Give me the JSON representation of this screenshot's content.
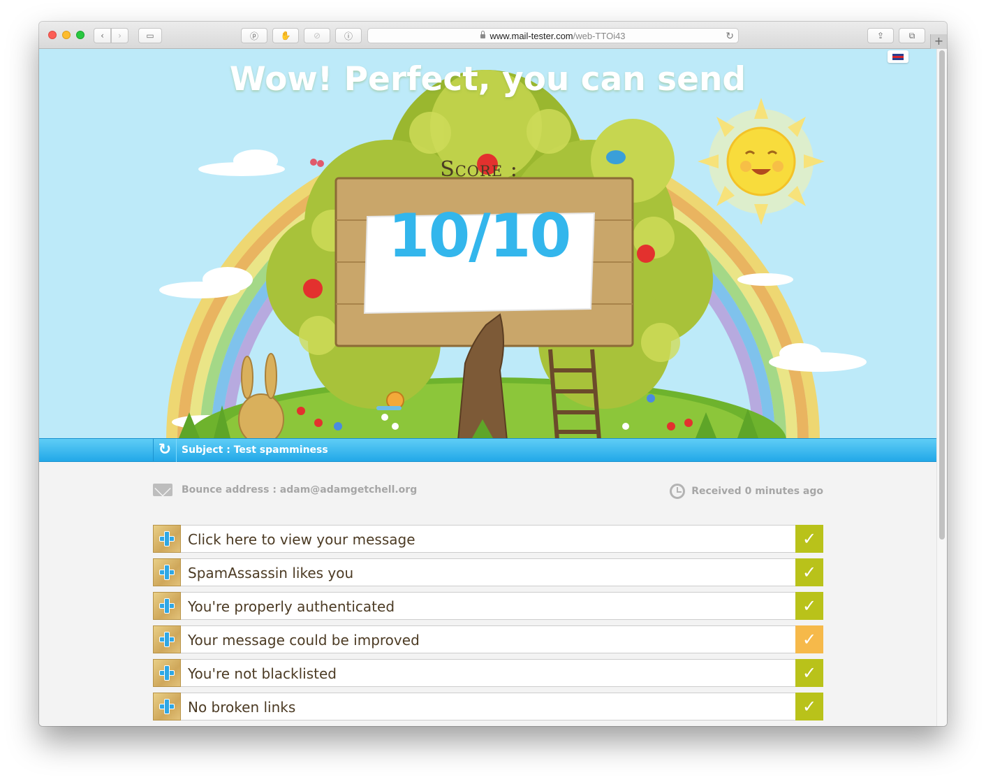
{
  "browser": {
    "url_domain": "www.mail-tester.com",
    "url_path": "/web-TTOi43",
    "new_tab_label": "+"
  },
  "hero": {
    "headline": "Wow! Perfect, you can send",
    "score_label": "Score :",
    "score_value": "10/10"
  },
  "subject": {
    "text": "Subject : Test spamminess"
  },
  "meta": {
    "bounce": "Bounce address : adam@adamgetchell.org",
    "received": "Received 0 minutes ago"
  },
  "checks": [
    {
      "label": "Click here to view your message",
      "status": "pass",
      "color": "#b9c21a"
    },
    {
      "label": "SpamAssassin likes you",
      "status": "pass",
      "color": "#b9c21a"
    },
    {
      "label": "You're properly authenticated",
      "status": "pass",
      "color": "#b9c21a"
    },
    {
      "label": "Your message could be improved",
      "status": "warning",
      "color": "#f6b94a"
    },
    {
      "label": "You're not blacklisted",
      "status": "pass",
      "color": "#b9c21a"
    },
    {
      "label": "No broken links",
      "status": "pass",
      "color": "#b9c21a"
    }
  ],
  "colors": {
    "sky": "#bdeaf9",
    "accent_blue": "#33b6ec",
    "pass_green": "#b9c21a",
    "warning_orange": "#f6b94a"
  }
}
